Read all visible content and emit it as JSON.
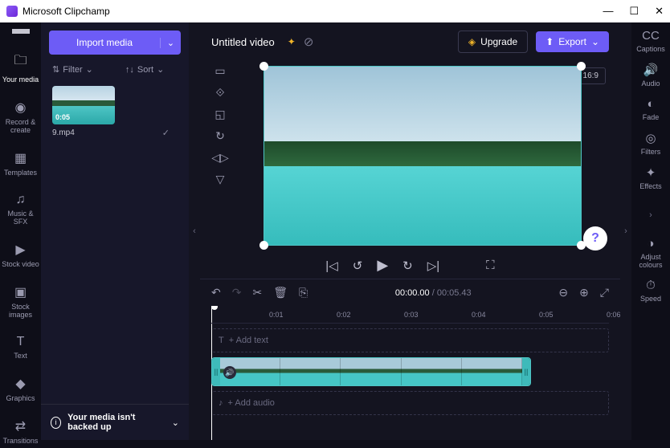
{
  "titlebar": {
    "app_name": "Microsoft Clipchamp"
  },
  "import_button": {
    "label": "Import media"
  },
  "filtersort": {
    "filter": "Filter",
    "sort": "Sort"
  },
  "media": {
    "duration": "0:05",
    "name": "9.mp4"
  },
  "backup": {
    "text": "Your media isn't backed up"
  },
  "project": {
    "title": "Untitled video"
  },
  "upgrade": {
    "label": "Upgrade"
  },
  "export": {
    "label": "Export"
  },
  "aspect": {
    "label": "16:9"
  },
  "time": {
    "current": "00:00.00",
    "duration": "00:05.43"
  },
  "ruler": {
    "ticks": [
      "0:01",
      "0:02",
      "0:03",
      "0:04",
      "0:05",
      "0:06"
    ]
  },
  "tracks": {
    "text": "+ Add text",
    "audio": "+ Add audio"
  },
  "left_nav": {
    "your_media": "Your media",
    "record": "Record & create",
    "templates": "Templates",
    "music": "Music & SFX",
    "stock_video": "Stock video",
    "stock_images": "Stock images",
    "text": "Text",
    "graphics": "Graphics",
    "transitions": "Transitions"
  },
  "right_nav": {
    "captions": "Captions",
    "audio": "Audio",
    "fade": "Fade",
    "filters": "Filters",
    "effects": "Effects",
    "colours": "Adjust colours",
    "speed": "Speed"
  }
}
